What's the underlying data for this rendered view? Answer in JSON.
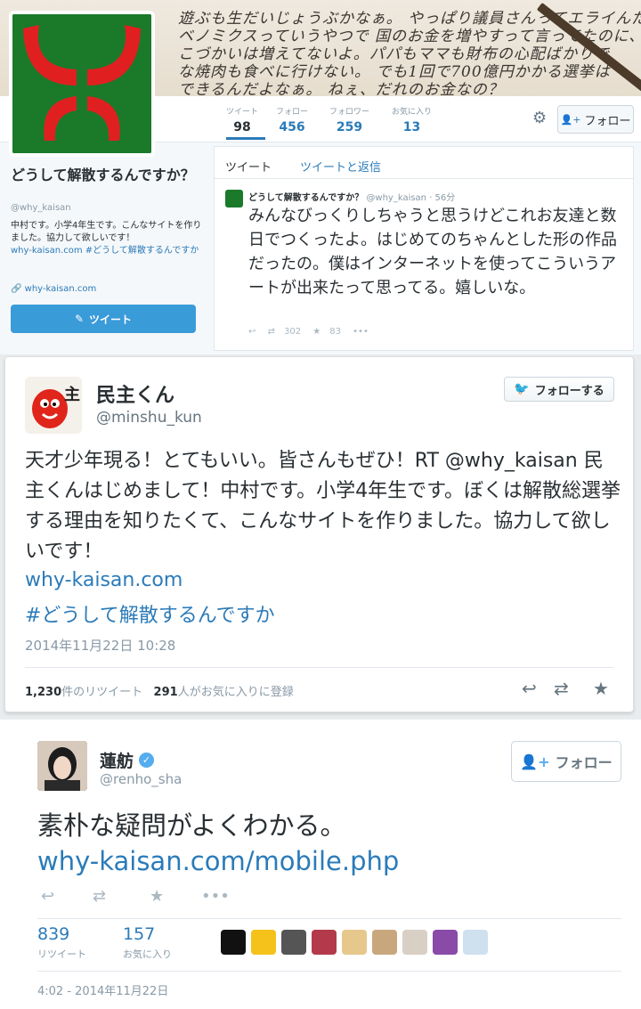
{
  "colors": {
    "link": "#2b7bb9",
    "tweet_button": "#3a9bd9",
    "verified": "#55acee",
    "avatar_green": "#1a7a2a",
    "avatar_red": "#e02020"
  },
  "profile": {
    "header_lines": [
      "遊ぶも生だいじょうぶかなぁ。 やっぱり議員さんってエライんだ",
      "ベノミクスっていうやつで 国のお金を増やすって言ってたのに、",
      "こづかいは増えてないよ。パパもママも財布の心配ばかりで",
      "な焼肉も食べに行けない。 でも1回で700億円かかる選挙は",
      "できるんだよなぁ。 ねぇ、だれのお金なの？"
    ],
    "stats": [
      {
        "label": "ツイート",
        "value": "98"
      },
      {
        "label": "フォロー",
        "value": "456"
      },
      {
        "label": "フォロワー",
        "value": "259"
      },
      {
        "label": "お気に入り",
        "value": "13"
      }
    ],
    "follow_label": "フォロー",
    "name": "どうして解散するんですか？",
    "handle": "@why_kaisan",
    "bio": "中村です。小学4年生です。こんなサイトを作りました。協力して欲しいです！",
    "bio_link": "why-kaisan.com",
    "bio_hashtag": "#どうして解散するんですか",
    "website": "why-kaisan.com",
    "tweet_button": "ツイート",
    "tabs": [
      "ツイート",
      "ツイートと返信"
    ],
    "tweet": {
      "name": "どうして解散するんですか？",
      "handle": "@why_kaisan · 56分",
      "text": "みんなびっくりしちゃうと思うけどこれお友達と数日でつくったよ。はじめてのちゃんとした形の作品だったの。僕はインターネットを使ってこういうアートが出来たって思ってる。嬉しいな。",
      "retweets": "302",
      "favorites": "83"
    }
  },
  "embed": {
    "name": "民主くん",
    "handle": "@minshu_kun",
    "follow_label": "フォローする",
    "text": "天才少年現る！とてもいい。皆さんもぜひ！RT @why_kaisan 民主くんはじめまして！中村です。小学4年生です。ぼくは解散総選挙する理由を知りたくて、こんなサイトを作りました。協力して欲しいです！",
    "link": "why-kaisan.com",
    "hashtag": "#どうして解散するんですか",
    "date": "2014年11月22日 10:28",
    "retweet_count": "1,230",
    "retweet_label": "件のリツイート",
    "fav_count": "291",
    "fav_label": "人がお気に入りに登録"
  },
  "mobile": {
    "name": "蓮舫",
    "handle": "@renho_sha",
    "follow_label": "フォロー",
    "text": "素朴な疑問がよくわかる。",
    "link": "why-kaisan.com/mobile.php",
    "retweets": "839",
    "retweets_label": "リツイート",
    "favorites": "157",
    "favorites_label": "お気に入り",
    "date": "4:02 - 2014年11月22日"
  }
}
